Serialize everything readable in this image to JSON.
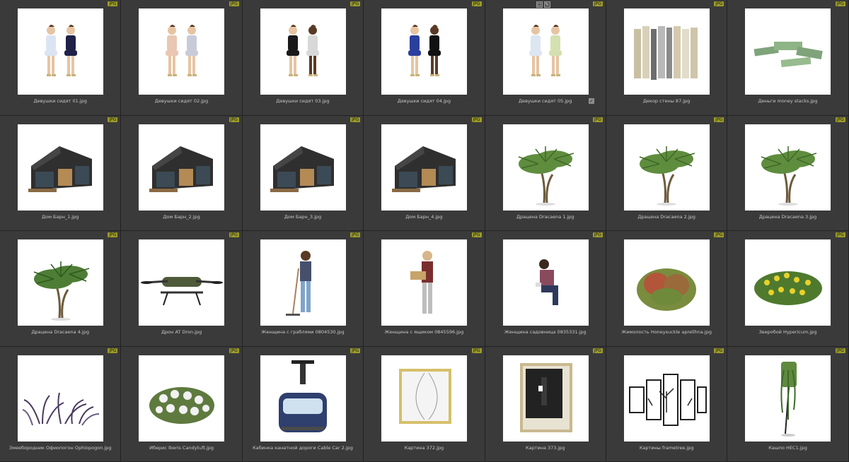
{
  "grid": {
    "badge_label": "JPG",
    "items": [
      {
        "caption": "Девушки сидят 01.jpg",
        "icon": "two-women-sitting-icon"
      },
      {
        "caption": "Девушки сидят 02.jpg",
        "icon": "two-women-sitting-icon"
      },
      {
        "caption": "Девушки сидят 03.jpg",
        "icon": "two-women-sitting-icon"
      },
      {
        "caption": "Девушки сидят 04.jpg",
        "icon": "two-women-sitting-icon"
      },
      {
        "caption": "Девушки сидят 05.jpg",
        "icon": "two-women-sitting-icon"
      },
      {
        "caption": "Декор стены 87.jpg",
        "icon": "wall-panels-icon"
      },
      {
        "caption": "Деньги money stacks.jpg",
        "icon": "money-stacks-icon"
      },
      {
        "caption": "Дом Барн_1.jpg",
        "icon": "barn-house-icon"
      },
      {
        "caption": "Дом Барн_2.jpg",
        "icon": "barn-house-icon"
      },
      {
        "caption": "Дом Барн_3.jpg",
        "icon": "barn-house-icon"
      },
      {
        "caption": "Дом Барн_4.jpg",
        "icon": "barn-house-icon"
      },
      {
        "caption": "Драцена Dracaena 1.jpg",
        "icon": "dracaena-plant-icon"
      },
      {
        "caption": "Драцена Dracaena 2.jpg",
        "icon": "dracaena-plant-icon"
      },
      {
        "caption": "Драцена Dracaena 3.jpg",
        "icon": "dracaena-plant-icon"
      },
      {
        "caption": "Драцена Dracaena 4.jpg",
        "icon": "dracaena-tree-icon"
      },
      {
        "caption": "Дрон AT Dron.jpg",
        "icon": "drone-icon"
      },
      {
        "caption": "Женщина с граблями 0804530.jpg",
        "icon": "woman-with-rake-icon"
      },
      {
        "caption": "Женщина с ящиком 0845596.jpg",
        "icon": "woman-with-box-icon"
      },
      {
        "caption": "Женщина садовница 0835331.jpg",
        "icon": "woman-gardener-icon"
      },
      {
        "caption": "Жимолость Honeysuckle aprelihna.jpg",
        "icon": "shrub-icon"
      },
      {
        "caption": "Зверобой Hypericum.jpg",
        "icon": "yellow-flower-bush-icon"
      },
      {
        "caption": "Змееборoдник Офиопогон Ophiopogon.jpg",
        "icon": "purple-grass-icon"
      },
      {
        "caption": "Иберис Iberis Candytuft.jpg",
        "icon": "white-flower-bush-icon"
      },
      {
        "caption": "Кабинка канатной дороги Cable Car 2.jpg",
        "icon": "cable-car-icon"
      },
      {
        "caption": "Картина 372.jpg",
        "icon": "framed-art-icon"
      },
      {
        "caption": "Картина 373.jpg",
        "icon": "framed-art-dark-icon"
      },
      {
        "caption": "Картины frametree.jpg",
        "icon": "tree-frames-icon"
      },
      {
        "caption": "Кашпо HEC1.jpg",
        "icon": "hanging-planter-icon"
      }
    ]
  },
  "toolbar": {
    "buttons": [
      {
        "icon": "square-icon",
        "label": "□"
      },
      {
        "icon": "pencil-icon",
        "label": "✎"
      }
    ]
  },
  "checkbox": {
    "label": "✓"
  }
}
